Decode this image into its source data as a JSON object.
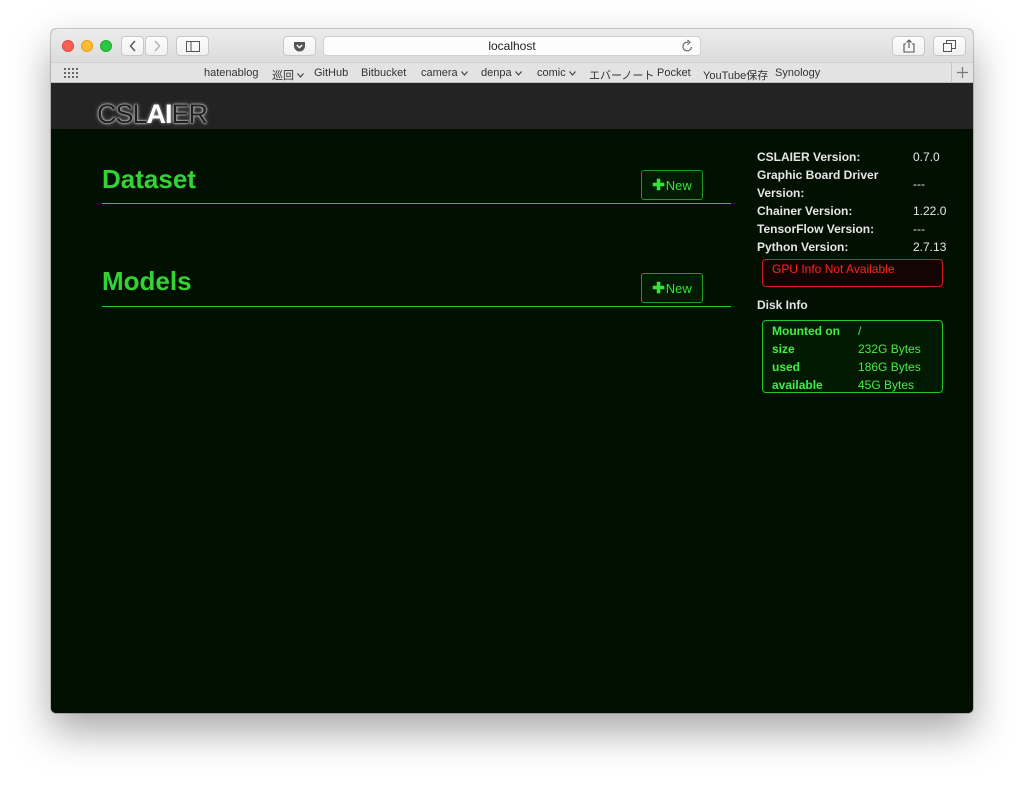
{
  "browser": {
    "url": "localhost",
    "bookmarks": [
      "hatenablog",
      "巡回",
      "GitHub",
      "Bitbucket",
      "camera",
      "denpa",
      "comic",
      "エバーノート",
      "Pocket",
      "YouTube保存",
      "Synology"
    ]
  },
  "app": {
    "logo_dim_left": "CSL",
    "logo_bright": "AI",
    "logo_dim_right": "ER"
  },
  "sections": {
    "dataset": {
      "title": "Dataset",
      "new_label": "New"
    },
    "models": {
      "title": "Models",
      "new_label": "New"
    }
  },
  "sidebar": {
    "versions": [
      {
        "label": "CSLAIER Version:",
        "value": "0.7.0"
      },
      {
        "label": "Graphic Board Driver Version:",
        "value": "---"
      },
      {
        "label": "Chainer Version:",
        "value": "1.22.0"
      },
      {
        "label": "TensorFlow Version:",
        "value": "---"
      },
      {
        "label": "Python Version:",
        "value": "2.7.13"
      }
    ],
    "gpu_info": "GPU Info Not Available",
    "disk_info_title": "Disk Info",
    "disk": [
      {
        "label": "Mounted on",
        "value": "/"
      },
      {
        "label": "size",
        "value": "232G Bytes"
      },
      {
        "label": "used",
        "value": "186G Bytes"
      },
      {
        "label": "available",
        "value": "45G Bytes"
      }
    ]
  },
  "colors": {
    "accent_green": "#34d334",
    "error_red": "#ff2222",
    "page_background": "#021002",
    "header_background": "#232323"
  }
}
